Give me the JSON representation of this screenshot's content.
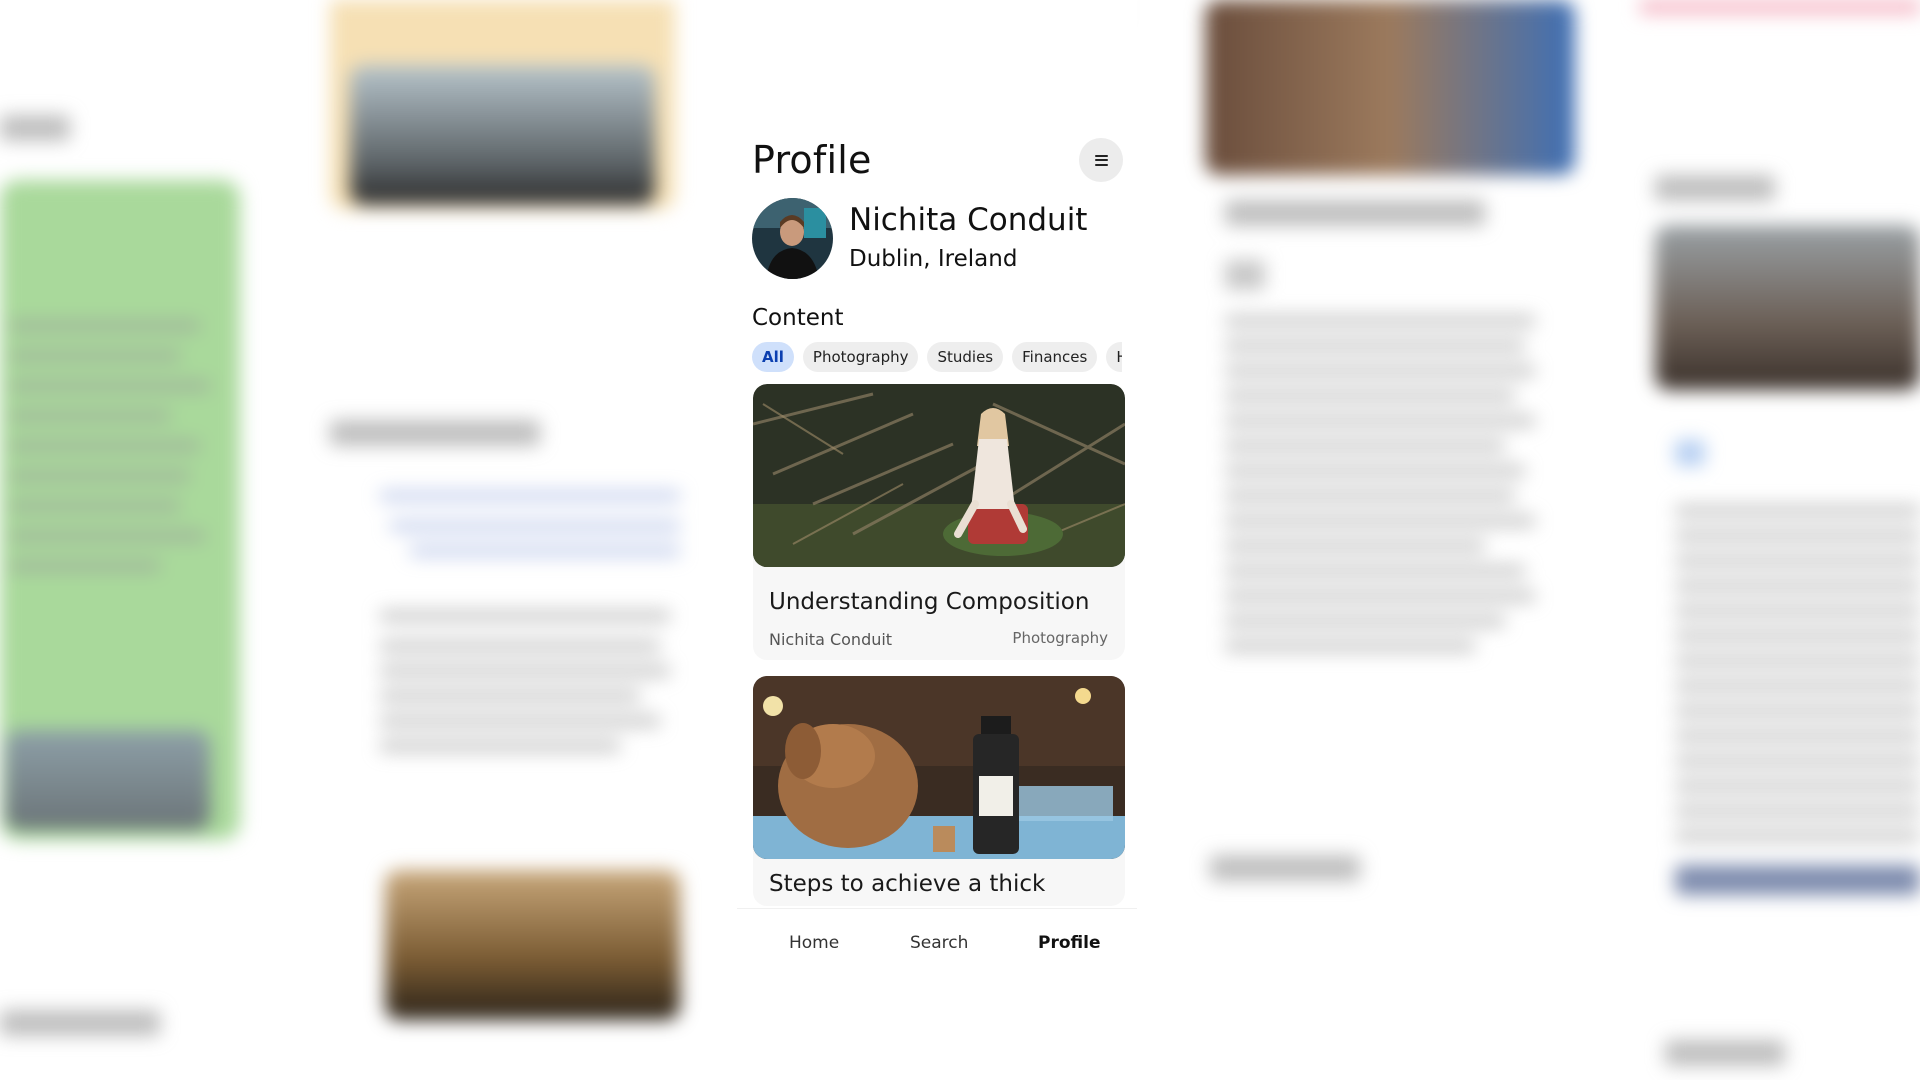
{
  "header": {
    "title": "Profile",
    "menu_icon": "hamburger-menu-icon"
  },
  "user": {
    "name": "Nichita Conduit",
    "location": "Dublin, Ireland"
  },
  "content": {
    "section_title": "Content",
    "filters": [
      "All",
      "Photography",
      "Studies",
      "Finances",
      "He"
    ],
    "active_filter": "All"
  },
  "cards": [
    {
      "title": "Understanding Composition",
      "author": "Nichita Conduit",
      "category": "Photography"
    },
    {
      "title": "Steps to achieve a thick"
    }
  ],
  "tabbar": {
    "home": "Home",
    "search": "Search",
    "profile": "Profile",
    "active": "Profile"
  },
  "colors": {
    "accent": "#cfe0fb",
    "accent_text": "#0b3fb0",
    "card_bg": "#f7f7f7"
  }
}
